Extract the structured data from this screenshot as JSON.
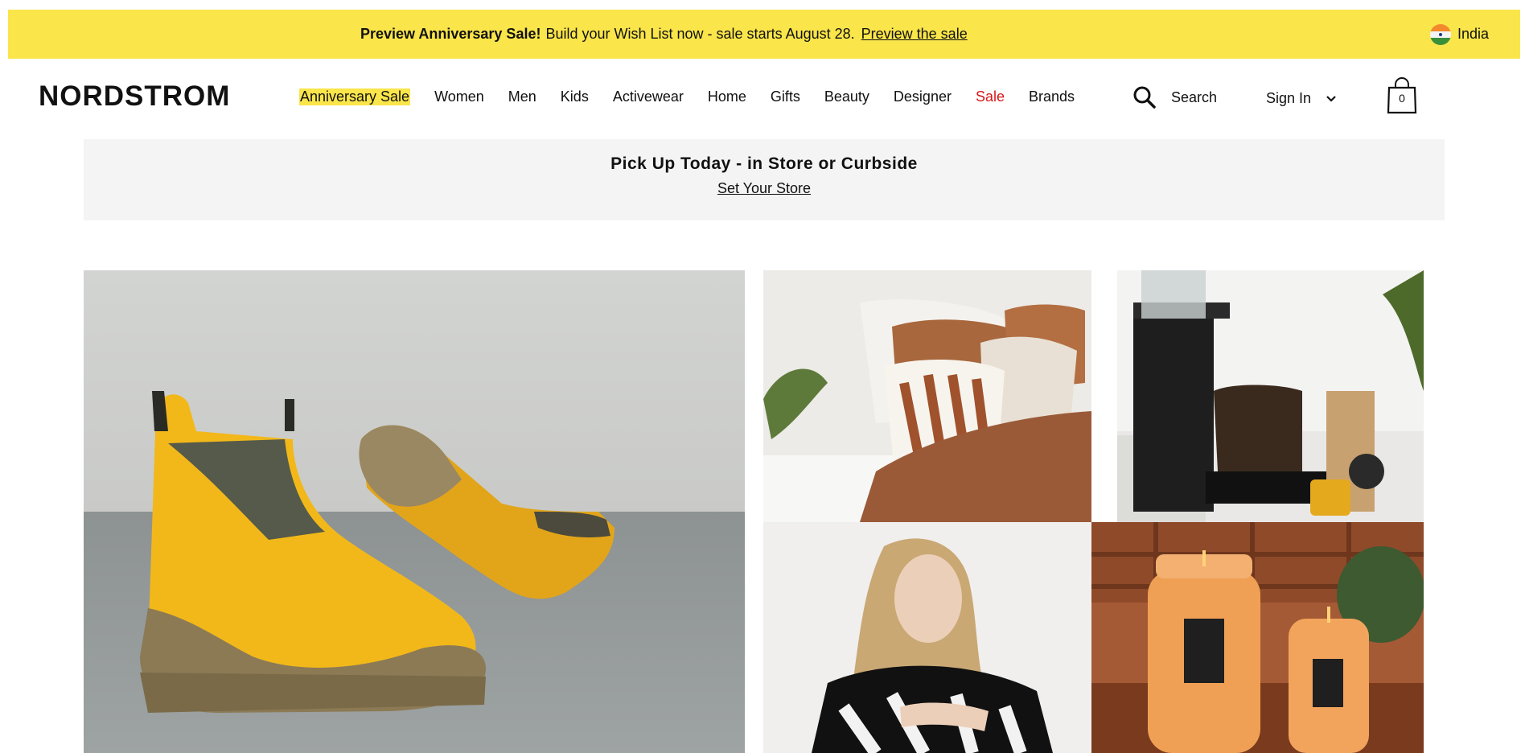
{
  "promo": {
    "bold": "Preview Anniversary Sale!",
    "text": "Build your Wish List now - sale starts August 28.",
    "link": "Preview the sale",
    "country": "India",
    "bg_color": "#fae54a"
  },
  "header": {
    "logo": "NORDSTROM",
    "nav": [
      {
        "label": "Anniversary Sale"
      },
      {
        "label": "Women"
      },
      {
        "label": "Men"
      },
      {
        "label": "Kids"
      },
      {
        "label": "Activewear"
      },
      {
        "label": "Home"
      },
      {
        "label": "Gifts"
      },
      {
        "label": "Beauty"
      },
      {
        "label": "Designer"
      },
      {
        "label": "Sale",
        "color": "#d6171b"
      },
      {
        "label": "Brands"
      }
    ],
    "search_label": "Search",
    "signin_label": "Sign In",
    "bag_count": "0"
  },
  "store_banner": {
    "title": "Pick Up Today - in Store or Curbside",
    "link": "Set Your Store"
  },
  "icons": {
    "search": "search-icon",
    "chevron": "chevron-down-icon",
    "bag": "shopping-bag-icon",
    "flag": "india-flag-icon"
  }
}
